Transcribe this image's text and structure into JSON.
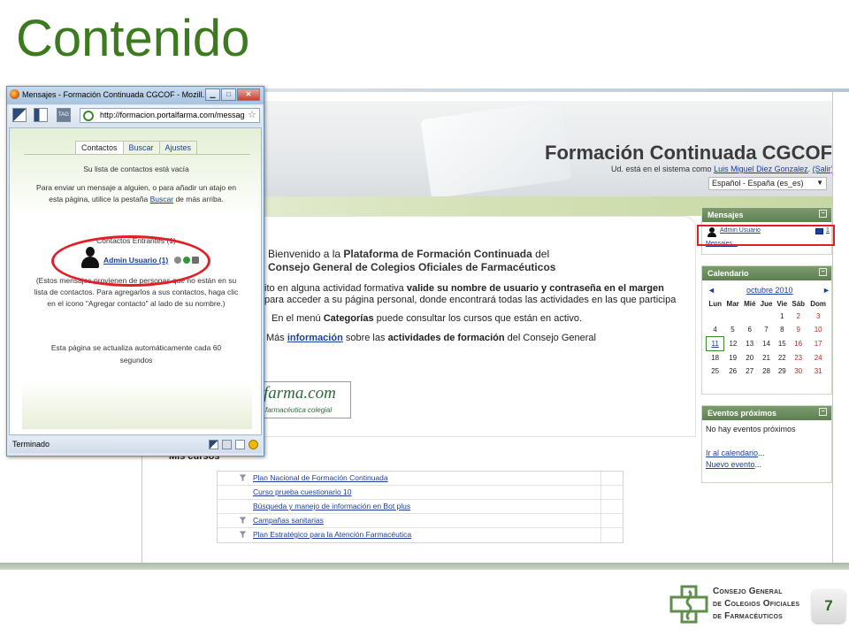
{
  "slide": {
    "title": "Contenido",
    "page_number": "7",
    "footer_org": [
      "Consejo General",
      "de Colegios Oficiales",
      "de Farmacéuticos"
    ]
  },
  "site": {
    "title": "Formación Continuada CGCOF",
    "login_prefix": "Ud. está en el sistema como",
    "login_user": "Luis Miguel Diez Gonzalez",
    "login_sep": ".",
    "logout_label": "(Salir)",
    "language": "Español - España (es_es)",
    "welcome_1_pre": "Bienvenido a la",
    "welcome_1_bold": "Plataforma de Formación Continuada",
    "welcome_1_post": "del",
    "welcome_2_bold": "Consejo General de Colegios Oficiales de Farmacéuticos",
    "para_1_pre": "ito en alguna actividad formativa",
    "para_1_bold": "valide su nombre de usuario y contraseña en el margen",
    "para_2": "para acceder a su página personal, donde encontrará todas las actividades en las que participa",
    "menu_pre": "En el menú",
    "menu_bold": "Categorías",
    "menu_post": "puede consultar los cursos que están en activo.",
    "mas_pre": "Más",
    "mas_link": "información",
    "mas_mid": "sobre las",
    "mas_bold": "actividades de formación",
    "mas_post": "del Consejo General",
    "logo_main": "farma.com",
    "logo_sub": "farmacéutica colegial",
    "mis_cursos": "Mis cursos",
    "courses": [
      "Plan Nacional de Formación Continuada",
      "Curso prueba cuestionario 10",
      "Búsqueda y manejo de información en Bot plus",
      "Campañas sanitarias",
      "Plan Estratégico para la Atención Farmacéutica"
    ]
  },
  "blocks": {
    "mensajes_title": "Mensajes",
    "mensajes_user": "Admin Usuario",
    "mensajes_count": "1",
    "mensajes_link": "Mensajes...",
    "calendario_title": "Calendario",
    "cal_month": "octubre 2010",
    "cal_prev": "◄",
    "cal_next": "►",
    "cal_days": [
      "Lun",
      "Mar",
      "Mié",
      "Jue",
      "Vie",
      "Sáb",
      "Dom"
    ],
    "cal_weeks": [
      [
        "",
        "",
        "",
        "",
        "1",
        "2",
        "3"
      ],
      [
        "4",
        "5",
        "6",
        "7",
        "8",
        "9",
        "10"
      ],
      [
        "11",
        "12",
        "13",
        "14",
        "15",
        "16",
        "17"
      ],
      [
        "18",
        "19",
        "20",
        "21",
        "22",
        "23",
        "24"
      ],
      [
        "25",
        "26",
        "27",
        "28",
        "29",
        "30",
        "31"
      ]
    ],
    "eventos_title": "Eventos próximos",
    "eventos_empty": "No hay eventos próximos",
    "eventos_link1": "Ir al calendario",
    "eventos_link2": "Nuevo evento"
  },
  "popup": {
    "title": "Mensajes - Formación Continuada CGCOF - Mozill...",
    "url": "http://formacion.portalfarma.com/messag",
    "tabs": [
      "Contactos",
      "Buscar",
      "Ajustes"
    ],
    "empty_list": "Su lista de contactos está vacía",
    "instruction_1": "Para enviar un mensaje a alguien, o para añadir un atajo en",
    "instruction_2_pre": "esta página, utilice la pestaña",
    "instruction_2_link": "Buscar",
    "instruction_2_post": "de más arriba.",
    "incoming_title": "Contactos Entrantes (1)",
    "incoming_user": "Admin Usuario (1)",
    "note_1": "(Estos mensajes provienen de personas que no están en su",
    "note_2": "lista de contactos. Para agregarlos a sus contactos, haga clic",
    "note_3": "en el icono \"Agregar contacto\" al lado de su nombre.)",
    "refresh_1": "Esta página se actualiza automáticamente cada 60",
    "refresh_2": "segundos",
    "status": "Terminado"
  },
  "colors": {
    "title_green": "#3b7a1d",
    "highlight_red": "#e31e25",
    "link_blue": "#1a3f9c"
  }
}
